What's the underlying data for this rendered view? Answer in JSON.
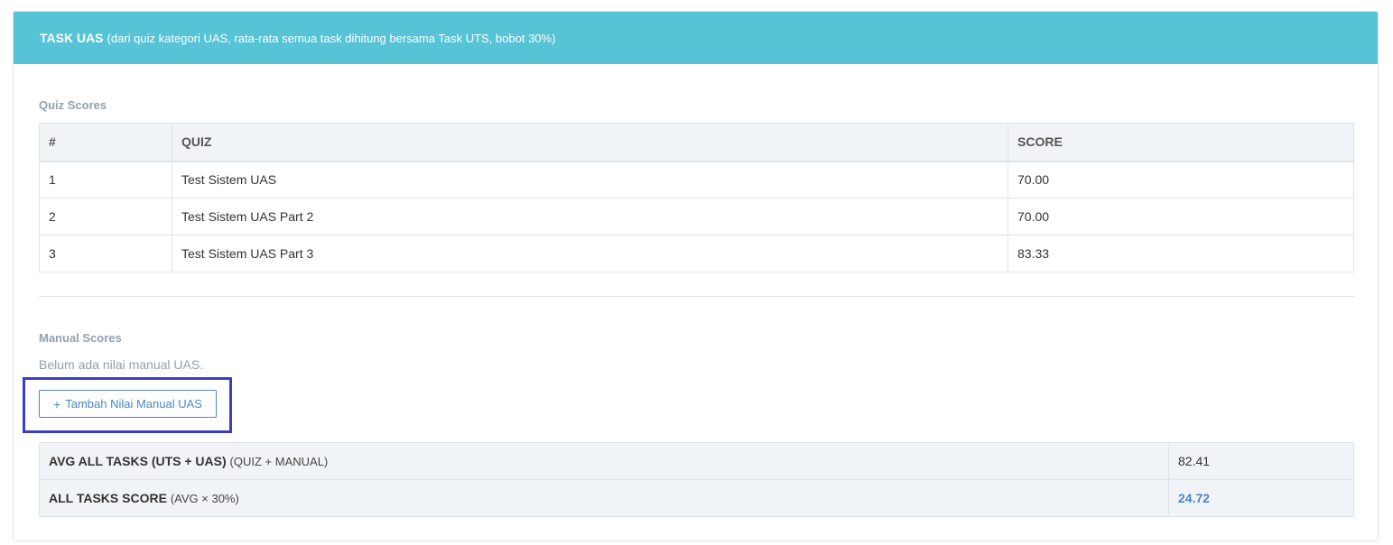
{
  "header": {
    "title": "TASK UAS",
    "subtitle": "(dari quiz kategori UAS, rata-rata semua task dihitung bersama Task UTS, bobot 30%)"
  },
  "quiz_section": {
    "label": "Quiz Scores",
    "columns": [
      "#",
      "QUIZ",
      "SCORE"
    ],
    "rows": [
      {
        "no": "1",
        "quiz": "Test Sistem UAS",
        "score": "70.00"
      },
      {
        "no": "2",
        "quiz": "Test Sistem UAS Part 2",
        "score": "70.00"
      },
      {
        "no": "3",
        "quiz": "Test Sistem UAS Part 3",
        "score": "83.33"
      }
    ]
  },
  "manual_section": {
    "label": "Manual Scores",
    "empty_text": "Belum ada nilai manual UAS.",
    "add_button_icon": "+",
    "add_button_label": "Tambah Nilai Manual UAS"
  },
  "summary": {
    "avg_label": "AVG ALL TASKS (UTS + UAS)",
    "avg_note": "(QUIZ + MANUAL)",
    "avg_value": "82.41",
    "score_label": "ALL TASKS SCORE",
    "score_note": "(AVG × 30%)",
    "score_value": "24.72"
  },
  "colors": {
    "header_bg": "#56c3d7",
    "accent": "#4a86c8",
    "highlight": "#3b3ec2"
  }
}
